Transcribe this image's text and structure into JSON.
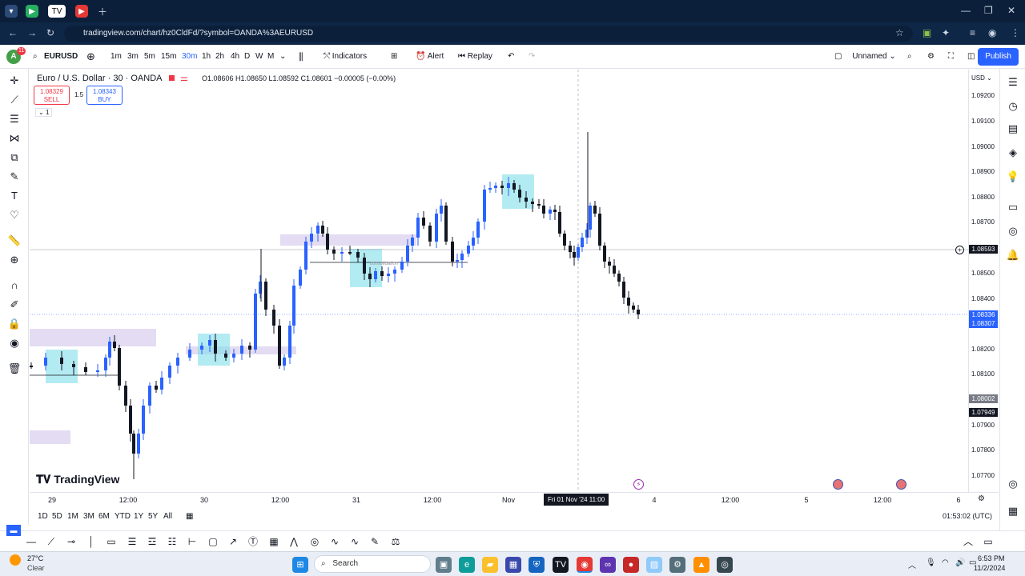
{
  "browser": {
    "url": "tradingview.com/chart/hz0CldFd/?symbol=OANDA%3AEURUSD"
  },
  "toolbar": {
    "avatar_letter": "A",
    "avatar_badge": "11",
    "symbol": "EURUSD",
    "intervals": [
      "1m",
      "3m",
      "5m",
      "15m",
      "30m",
      "1h",
      "2h",
      "4h",
      "D",
      "W",
      "M"
    ],
    "active_interval": "30m",
    "indicators_label": "Indicators",
    "alert_label": "Alert",
    "replay_label": "Replay",
    "layout_name": "Unnamed",
    "publish_label": "Publish"
  },
  "legend": {
    "title": "Euro / U.S. Dollar · 30 · OANDA",
    "ohlc": "O1.08606  H1.08650  L1.08592  C1.08601  −0.00005 (−0.00%)",
    "sell_price": "1.08329",
    "sell_label": "SELL",
    "spread": "1.5",
    "buy_price": "1.08343",
    "buy_label": "BUY",
    "collapse_count": "1"
  },
  "price_scale": {
    "currency": "USD",
    "ticks": [
      "1.09200",
      "1.09100",
      "1.09000",
      "1.08900",
      "1.08800",
      "1.08700",
      "1.08500",
      "1.08400",
      "1.08200",
      "1.08100",
      "1.07900",
      "1.07800",
      "1.07700"
    ],
    "crosshair_price": "1.08593",
    "last_price": "1.08336",
    "last_price_2": "1.08307",
    "level_1": "1.08002",
    "level_2": "1.07949"
  },
  "time_scale": {
    "ticks": [
      "29",
      "12:00",
      "30",
      "12:00",
      "31",
      "12:00",
      "Nov",
      "12:00",
      "4",
      "12:00",
      "5",
      "12:00",
      "6"
    ],
    "crosshair_label": "Fri 01 Nov '24   11:00"
  },
  "bottom_bar": {
    "ranges": [
      "1D",
      "5D",
      "1M",
      "3M",
      "6M",
      "YTD",
      "1Y",
      "5Y",
      "All"
    ],
    "clock": "01:53:02 (UTC)"
  },
  "watermark": "TradingView",
  "annotation_text": "consolidation",
  "taskbar": {
    "weather_temp": "27°C",
    "weather_text": "Clear",
    "search_label": "Search",
    "time": "6:53 PM",
    "date": "11/2/2024"
  },
  "colors": {
    "bull": "#2962ff",
    "bear": "#131722",
    "zone_purple": "#d1c4e9",
    "zone_cyan": "#80deea",
    "accent": "#2962ff"
  },
  "chart_data": {
    "type": "candlestick",
    "symbol": "EURUSD",
    "ylim": [
      1.0765,
      1.0928
    ],
    "current_price": 1.08336
  }
}
